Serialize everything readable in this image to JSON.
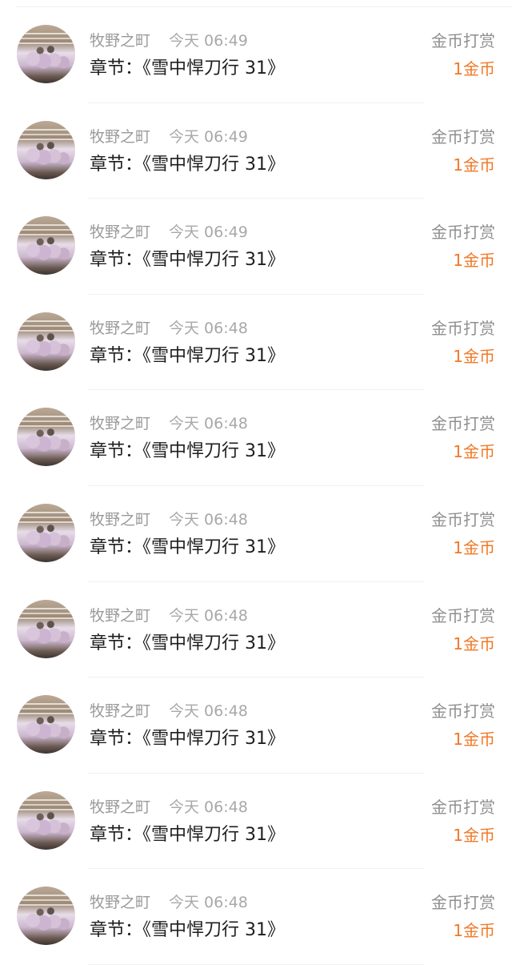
{
  "records": [
    {
      "username": "牧野之町",
      "time": "今天 06:49",
      "chapter": "章节：《雪中悍刀行 31》",
      "type": "金币打赏",
      "amount": "1金币"
    },
    {
      "username": "牧野之町",
      "time": "今天 06:49",
      "chapter": "章节：《雪中悍刀行 31》",
      "type": "金币打赏",
      "amount": "1金币"
    },
    {
      "username": "牧野之町",
      "time": "今天 06:49",
      "chapter": "章节：《雪中悍刀行 31》",
      "type": "金币打赏",
      "amount": "1金币"
    },
    {
      "username": "牧野之町",
      "time": "今天 06:48",
      "chapter": "章节：《雪中悍刀行 31》",
      "type": "金币打赏",
      "amount": "1金币"
    },
    {
      "username": "牧野之町",
      "time": "今天 06:48",
      "chapter": "章节：《雪中悍刀行 31》",
      "type": "金币打赏",
      "amount": "1金币"
    },
    {
      "username": "牧野之町",
      "time": "今天 06:48",
      "chapter": "章节：《雪中悍刀行 31》",
      "type": "金币打赏",
      "amount": "1金币"
    },
    {
      "username": "牧野之町",
      "time": "今天 06:48",
      "chapter": "章节：《雪中悍刀行 31》",
      "type": "金币打赏",
      "amount": "1金币"
    },
    {
      "username": "牧野之町",
      "time": "今天 06:48",
      "chapter": "章节：《雪中悍刀行 31》",
      "type": "金币打赏",
      "amount": "1金币"
    },
    {
      "username": "牧野之町",
      "time": "今天 06:48",
      "chapter": "章节：《雪中悍刀行 31》",
      "type": "金币打赏",
      "amount": "1金币"
    },
    {
      "username": "牧野之町",
      "time": "今天 06:48",
      "chapter": "章节：《雪中悍刀行 31》",
      "type": "金币打赏",
      "amount": "1金币"
    }
  ],
  "colors": {
    "amount": "#f07826",
    "muted_text": "#9a9a9a",
    "primary_text": "#1e1e1e",
    "divider": "#f1f1f1"
  },
  "icons": {
    "avatar": "user-avatar-photo"
  }
}
